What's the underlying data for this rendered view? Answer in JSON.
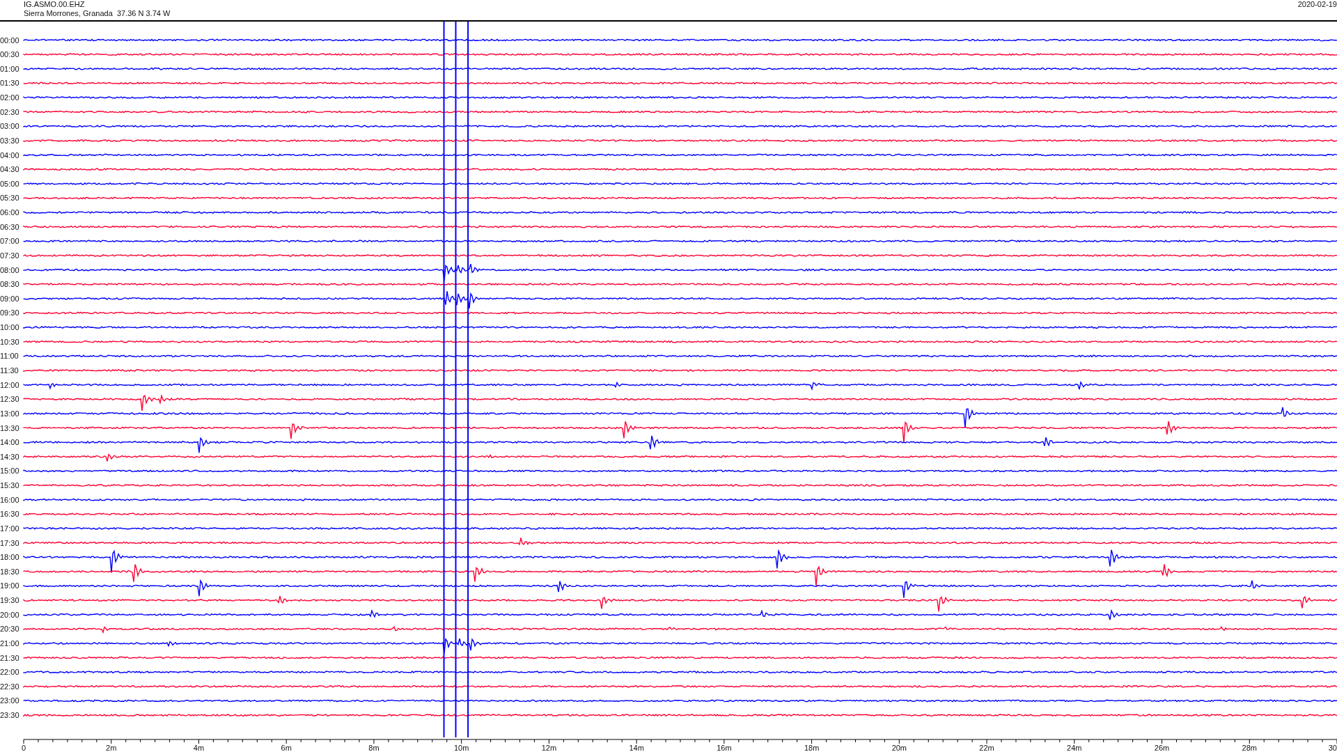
{
  "header": {
    "station": "IG.ASMO.00.EHZ",
    "location": "Sierra Morrones, Granada  37.36 N 3.74 W",
    "date": "2020-02-19"
  },
  "rows": [
    {
      "time": "00:00",
      "color": "#0000ff"
    },
    {
      "time": "00:30",
      "color": "#ff0033"
    },
    {
      "time": "01:00",
      "color": "#0000ff"
    },
    {
      "time": "01:30",
      "color": "#ff0033"
    },
    {
      "time": "02:00",
      "color": "#0000ff"
    },
    {
      "time": "02:30",
      "color": "#ff0033"
    },
    {
      "time": "03:00",
      "color": "#0000ff"
    },
    {
      "time": "03:30",
      "color": "#ff0033"
    },
    {
      "time": "04:00",
      "color": "#0000ff"
    },
    {
      "time": "04:30",
      "color": "#ff0033"
    },
    {
      "time": "05:00",
      "color": "#0000ff"
    },
    {
      "time": "05:30",
      "color": "#ff0033"
    },
    {
      "time": "06:00",
      "color": "#0000ff"
    },
    {
      "time": "06:30",
      "color": "#ff0033"
    },
    {
      "time": "07:00",
      "color": "#0000ff"
    },
    {
      "time": "07:30",
      "color": "#ff0033"
    },
    {
      "time": "08:00",
      "color": "#0000ff"
    },
    {
      "time": "08:30",
      "color": "#ff0033"
    },
    {
      "time": "09:00",
      "color": "#0000ff"
    },
    {
      "time": "09:30",
      "color": "#ff0033"
    },
    {
      "time": "10:00",
      "color": "#0000ff"
    },
    {
      "time": "10:30",
      "color": "#ff0033"
    },
    {
      "time": "11:00",
      "color": "#0000ff"
    },
    {
      "time": "11:30",
      "color": "#ff0033"
    },
    {
      "time": "12:00",
      "color": "#0000ff"
    },
    {
      "time": "12:30",
      "color": "#ff0033"
    },
    {
      "time": "13:00",
      "color": "#0000ff"
    },
    {
      "time": "13:30",
      "color": "#ff0033"
    },
    {
      "time": "14:00",
      "color": "#0000ff"
    },
    {
      "time": "14:30",
      "color": "#ff0033"
    },
    {
      "time": "15:00",
      "color": "#0000ff"
    },
    {
      "time": "15:30",
      "color": "#ff0033"
    },
    {
      "time": "16:00",
      "color": "#0000ff"
    },
    {
      "time": "16:30",
      "color": "#ff0033"
    },
    {
      "time": "17:00",
      "color": "#0000ff"
    },
    {
      "time": "17:30",
      "color": "#ff0033"
    },
    {
      "time": "18:00",
      "color": "#0000ff"
    },
    {
      "time": "18:30",
      "color": "#ff0033"
    },
    {
      "time": "19:00",
      "color": "#0000ff"
    },
    {
      "time": "19:30",
      "color": "#ff0033"
    },
    {
      "time": "20:00",
      "color": "#0000ff"
    },
    {
      "time": "20:30",
      "color": "#ff0033"
    },
    {
      "time": "21:00",
      "color": "#0000ff"
    },
    {
      "time": "21:30",
      "color": "#ff0033"
    },
    {
      "time": "22:00",
      "color": "#0000ff"
    },
    {
      "time": "22:30",
      "color": "#ff0033"
    },
    {
      "time": "23:00",
      "color": "#0000ff"
    },
    {
      "time": "23:30",
      "color": "#ff0033"
    }
  ],
  "x_axis": {
    "tick_labels": [
      "0",
      "2m",
      "4m",
      "6m",
      "8m",
      "10m",
      "12m",
      "14m",
      "16m",
      "18m",
      "20m",
      "22m",
      "24m",
      "26m",
      "28m",
      "30"
    ]
  }
}
